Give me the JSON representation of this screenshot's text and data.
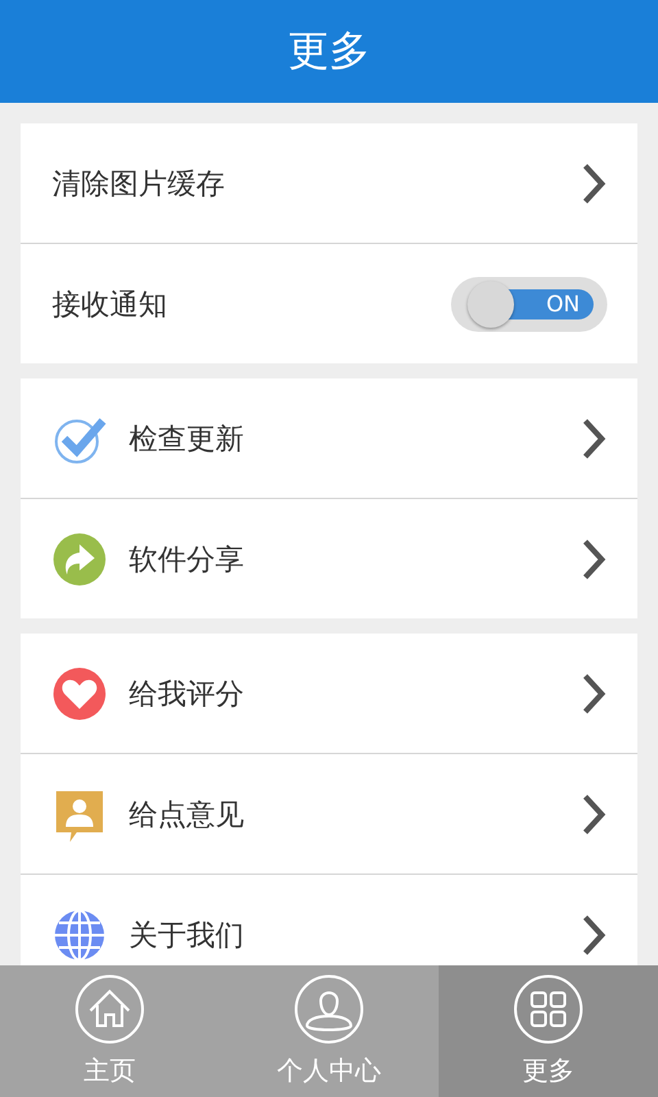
{
  "header": {
    "title": "更多"
  },
  "groups": [
    {
      "rows": [
        {
          "kind": "link",
          "label": "清除图片缓存"
        },
        {
          "kind": "toggle",
          "label": "接收通知",
          "on": true,
          "toggle_text": "ON"
        }
      ]
    },
    {
      "rows": [
        {
          "kind": "link",
          "label": "检查更新"
        },
        {
          "kind": "link",
          "label": "软件分享"
        }
      ]
    },
    {
      "rows": [
        {
          "kind": "link",
          "label": "给我评分"
        },
        {
          "kind": "link",
          "label": "给点意见"
        },
        {
          "kind": "link",
          "label": "关于我们"
        }
      ]
    }
  ],
  "tab_bar": [
    {
      "label": "主页",
      "selected": false
    },
    {
      "label": "个人中心",
      "selected": false
    },
    {
      "label": "更多",
      "selected": true
    }
  ]
}
